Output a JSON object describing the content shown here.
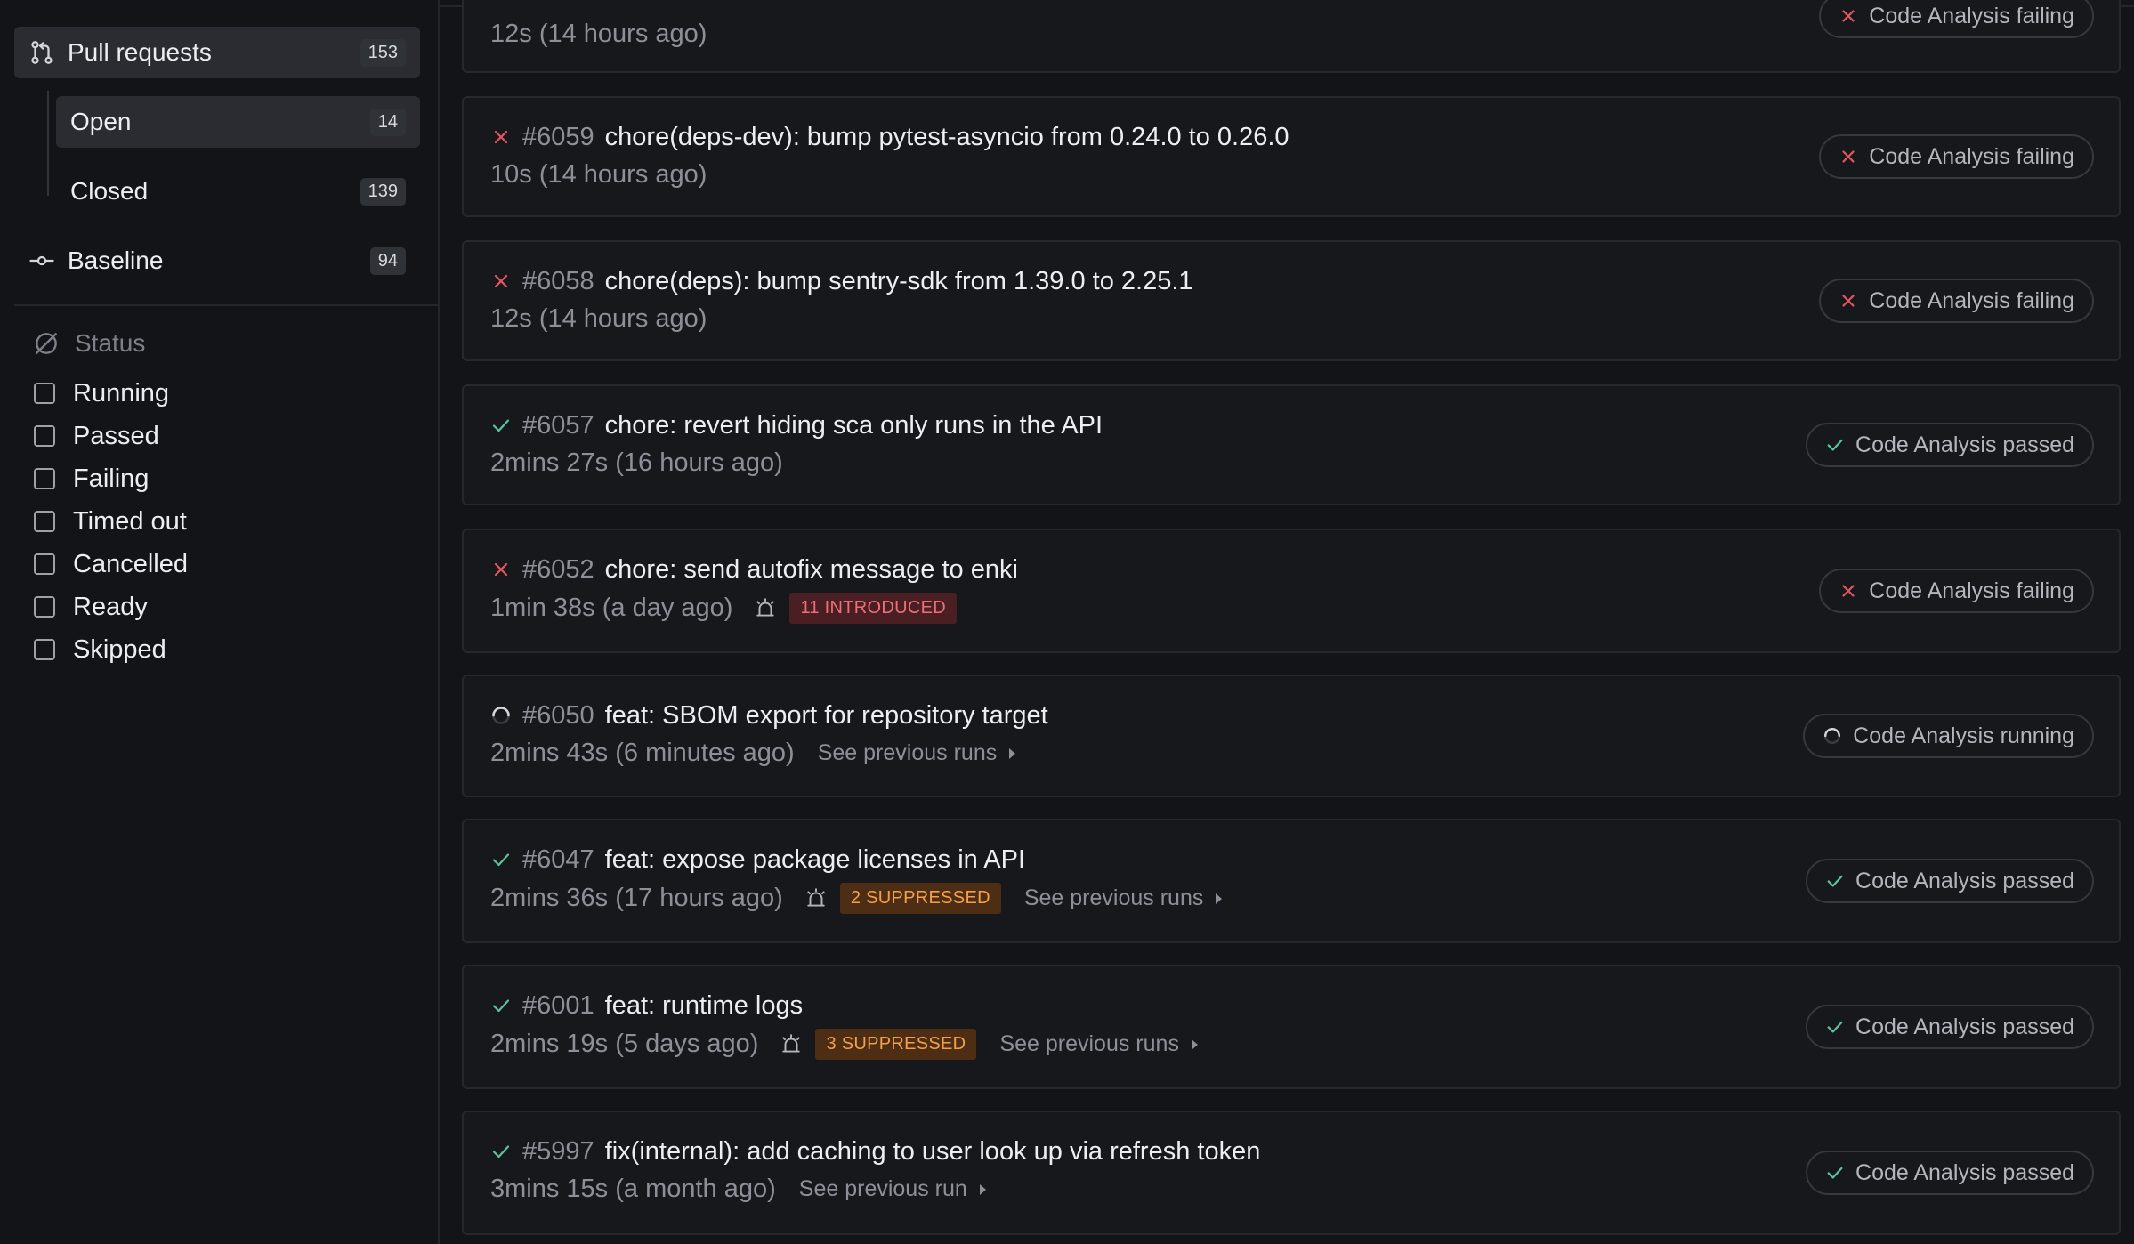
{
  "sidebar": {
    "pull_requests": {
      "label": "Pull requests",
      "count": "153"
    },
    "open": {
      "label": "Open",
      "count": "14"
    },
    "closed": {
      "label": "Closed",
      "count": "139"
    },
    "baseline": {
      "label": "Baseline",
      "count": "94"
    },
    "status_heading": "Status",
    "filters": [
      "Running",
      "Passed",
      "Failing",
      "Timed out",
      "Cancelled",
      "Ready",
      "Skipped"
    ]
  },
  "runs": [
    {
      "meta": "12s (14 hours ago)",
      "pill": "Code Analysis failing",
      "status": "failing"
    },
    {
      "number": "#6059",
      "title": "chore(deps-dev): bump pytest-asyncio from 0.24.0 to 0.26.0",
      "meta": "10s (14 hours ago)",
      "pill": "Code Analysis failing",
      "status": "failing"
    },
    {
      "number": "#6058",
      "title": "chore(deps): bump sentry-sdk from 1.39.0 to 2.25.1",
      "meta": "12s (14 hours ago)",
      "pill": "Code Analysis failing",
      "status": "failing"
    },
    {
      "number": "#6057",
      "title": "chore: revert hiding sca only runs in the API",
      "meta": "2mins 27s (16 hours ago)",
      "pill": "Code Analysis passed",
      "status": "passed"
    },
    {
      "number": "#6052",
      "title": "chore: send autofix message to enki",
      "meta": "1min 38s (a day ago)",
      "badge": "11 INTRODUCED",
      "pill": "Code Analysis failing",
      "status": "failing"
    },
    {
      "number": "#6050",
      "title": "feat: SBOM export for repository target",
      "meta": "2mins 43s (6 minutes ago)",
      "prev": "See previous runs",
      "pill": "Code Analysis running",
      "status": "running"
    },
    {
      "number": "#6047",
      "title": "feat: expose package licenses in API",
      "meta": "2mins 36s (17 hours ago)",
      "badge": "2 SUPPRESSED",
      "prev": "See previous runs",
      "pill": "Code Analysis passed",
      "status": "passed"
    },
    {
      "number": "#6001",
      "title": "feat: runtime logs",
      "meta": "2mins 19s (5 days ago)",
      "badge": "3 SUPPRESSED",
      "prev": "See previous runs",
      "pill": "Code Analysis passed",
      "status": "passed"
    },
    {
      "number": "#5997",
      "title": "fix(internal): add caching to user look up via refresh token",
      "meta": "3mins 15s (a month ago)",
      "prev": "See previous run",
      "pill": "Code Analysis passed",
      "status": "passed"
    }
  ],
  "colors": {
    "failing": "#e5575f",
    "passed": "#5cc49c",
    "running": "#c9ccd2",
    "accent": "#55b49a"
  }
}
